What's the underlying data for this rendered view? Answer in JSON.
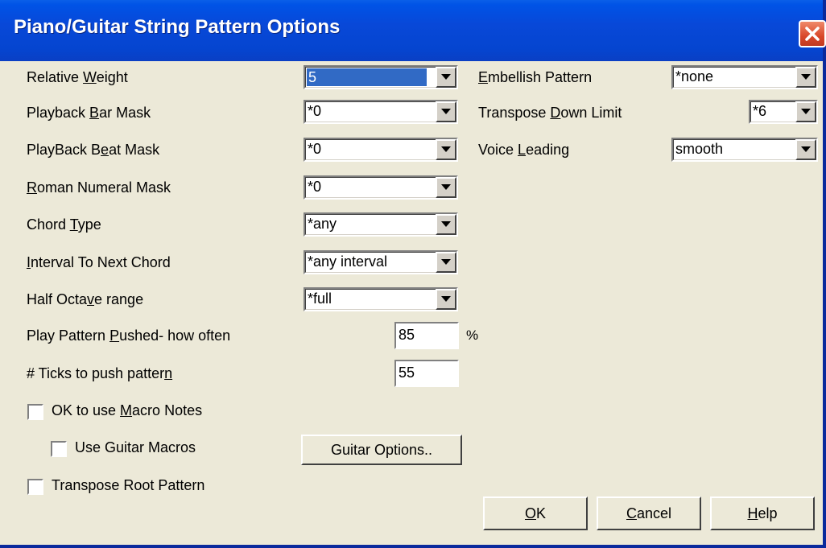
{
  "window": {
    "title": "Piano/Guitar String Pattern Options"
  },
  "left": {
    "relative_weight": {
      "label_pre": "Relative ",
      "label_key": "W",
      "label_post": "eight",
      "value": "5"
    },
    "playback_bar_mask": {
      "label_pre": "Playback ",
      "label_key": "B",
      "label_post": "ar Mask",
      "value": "*0"
    },
    "playback_beat_mask": {
      "label_pre": "PlayBack B",
      "label_key": "e",
      "label_post": "at Mask",
      "value": "*0"
    },
    "roman_numeral_mask": {
      "label_pre": "",
      "label_key": "R",
      "label_post": "oman Numeral Mask",
      "value": "*0"
    },
    "chord_type": {
      "label_pre": "Chord ",
      "label_key": "T",
      "label_post": "ype",
      "value": "*any"
    },
    "interval_to_next_chord": {
      "label_pre": "",
      "label_key": "I",
      "label_post": "nterval To Next Chord",
      "value": "*any interval"
    },
    "half_octave_range": {
      "label_pre": "Half Octa",
      "label_key": "v",
      "label_post": "e range",
      "value": "*full"
    },
    "play_pattern_pushed": {
      "label_pre": "Play Pattern ",
      "label_key": "P",
      "label_post": "ushed- how often",
      "value": "85",
      "unit": "%"
    },
    "ticks_to_push": {
      "label_pre": "# Ticks to push patter",
      "label_key": "n",
      "label_post": "",
      "value": "55"
    }
  },
  "checkboxes": {
    "macro_notes": {
      "label_pre": "OK to use ",
      "label_key": "M",
      "label_post": "acro Notes",
      "checked": false
    },
    "guitar_macros": {
      "label": "Use Guitar Macros",
      "checked": false
    },
    "transpose_root": {
      "label": "Transpose Root Pattern",
      "checked": false
    }
  },
  "right": {
    "embellish_pattern": {
      "label_pre": "",
      "label_key": "E",
      "label_post": "mbellish Pattern",
      "value": "*none"
    },
    "transpose_down_limit": {
      "label_pre": "Transpose ",
      "label_key": "D",
      "label_post": "own Limit",
      "value": "*6"
    },
    "voice_leading": {
      "label_pre": "Voice ",
      "label_key": "L",
      "label_post": "eading",
      "value": "smooth"
    }
  },
  "buttons": {
    "guitar_options": "Guitar Options..",
    "ok_key": "O",
    "ok_post": "K",
    "cancel_key": "C",
    "cancel_post": "ancel",
    "help_key": "H",
    "help_post": "elp"
  },
  "colors": {
    "titlebar": "#0548d8",
    "dialog_bg": "#ece9d8",
    "selection": "#316ac5",
    "close": "#d9482a"
  },
  "icons": {
    "close": "close-x-icon",
    "dropdown": "triangle-down-icon"
  }
}
